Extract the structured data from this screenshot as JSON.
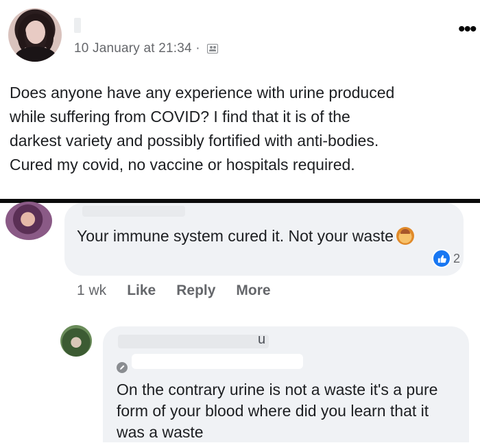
{
  "post": {
    "timestamp": "10 January at 21:34 ·",
    "body": "Does anyone have any experience with urine produced\nwhile suffering from COVID? I find that it is of the\ndarkest variety and possibly fortified with anti-bodies.\nCured my covid, no vaccine or hospitals required.",
    "audience_icon": "friends-icon",
    "menu_icon": "more-options-icon"
  },
  "comment1": {
    "text": "Your immune system cured it. Not your waste",
    "emoji": "person-facepalming-emoji",
    "reaction_count": "2",
    "reaction_icon": "like-icon",
    "time": "1 wk",
    "actions": {
      "like": "Like",
      "reply": "Reply",
      "more": "More"
    }
  },
  "comment2": {
    "name_fragment": "u",
    "text": "On the contrary urine is not a waste it's a pure form of your blood where did you learn that it was a waste"
  },
  "colors": {
    "bubble": "#f0f2f5",
    "meta": "#65676b",
    "like_blue": "#1877f2",
    "separator": "#0b0b0b"
  }
}
